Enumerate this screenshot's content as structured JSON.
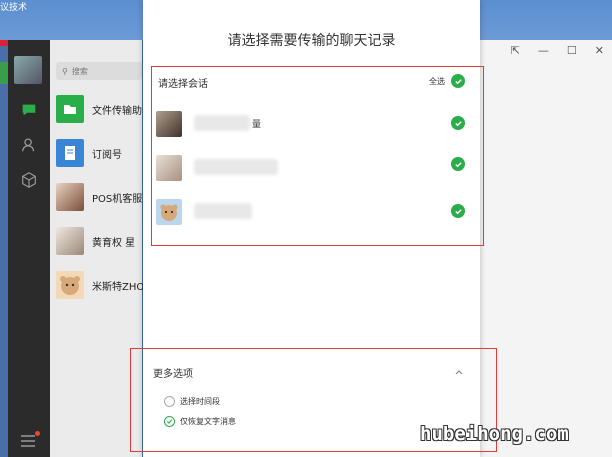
{
  "desktop": {
    "title_fragment": "议技术"
  },
  "window_controls": [
    "⇱",
    "—",
    "☐",
    "✕"
  ],
  "sidebar": {
    "icons": [
      "chat-bubble-icon",
      "contacts-icon",
      "cube-icon",
      "menu-icon"
    ]
  },
  "chatlist": {
    "search_placeholder": "搜索",
    "items": [
      {
        "name": "文件传输助",
        "icon": "folder-icon",
        "color": "#2aae4a"
      },
      {
        "name": "订阅号",
        "icon": "doc-icon",
        "color": "#3a85d6"
      },
      {
        "name": "POS机客服",
        "icon": "avatar",
        "color": "#b98a70"
      },
      {
        "name": "黄育权 星",
        "icon": "avatar",
        "color": "#c8b8a8"
      },
      {
        "name": "米斯特ZHO",
        "icon": "avatar",
        "color": "#d7a878"
      }
    ]
  },
  "dialog": {
    "title": "请选择需要传输的聊天记录",
    "select_header": "请选择会话",
    "select_all": "全选",
    "conversations": [
      {
        "name_suffix": "量",
        "checked": true
      },
      {
        "name_suffix": "",
        "checked": true
      },
      {
        "name_suffix": "",
        "checked": true
      }
    ],
    "more_options": {
      "title": "更多选项",
      "options": [
        {
          "label": "选择时间段",
          "checked": false
        },
        {
          "label": "仅恢复文字消息",
          "checked": true
        }
      ]
    }
  },
  "watermark": "hubeihong.com",
  "colors": {
    "accent_green": "#2aae4a",
    "highlight_red": "#e03a3a"
  }
}
